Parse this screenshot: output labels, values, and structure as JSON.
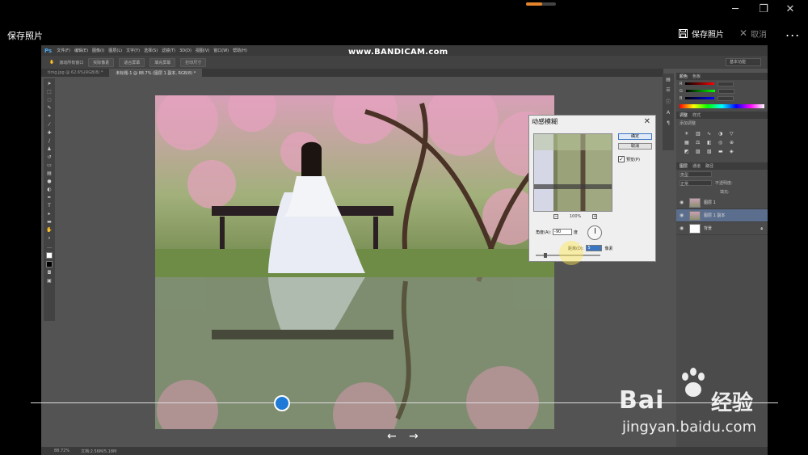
{
  "window": {
    "minimize_glyph": "─",
    "maximize_glyph": "❐",
    "close_glyph": "✕"
  },
  "viewer": {
    "title": "保存照片",
    "save_label": "保存照片",
    "cancel_label": "取消",
    "more_label": "...",
    "prev_glyph": "←",
    "next_glyph": "→",
    "accent_color": "#1e7ad6"
  },
  "photoshop": {
    "logo": "Ps",
    "menu": [
      "文件(F)",
      "编辑(E)",
      "图像(I)",
      "图层(L)",
      "文字(Y)",
      "选择(S)",
      "滤镜(T)",
      "3D(D)",
      "视图(V)",
      "窗口(W)",
      "帮助(H)"
    ],
    "recorder_watermark": "www.BANDICAM.com",
    "options": [
      "滚动所有窗口",
      "实际像素",
      "适合屏幕",
      "填充屏幕",
      "打印尺寸"
    ],
    "workspace": "基本功能",
    "tabs": [
      "timg.jpg @ 62.6%(RGB/8) *",
      "未标题-1 @ 88.7% (图层 1 副本, RGB/8) *"
    ],
    "status_zoom": "88.72%",
    "status_doc": "文档:2.56M/5.18M",
    "panels": {
      "color_tabs": [
        "颜色",
        "色板"
      ],
      "rgb_labels": [
        "R",
        "G",
        "B"
      ],
      "adjust_tabs": [
        "调整",
        "样式"
      ],
      "adjust_add": "添加调整",
      "layers_tabs": [
        "图层",
        "通道",
        "路径"
      ],
      "kind": "类型",
      "mode": "正常",
      "opacity": "不透明度:",
      "fill": "填充:",
      "layers": [
        {
          "name": "图层 1",
          "active": false
        },
        {
          "name": "图层 1 副本",
          "active": true
        },
        {
          "name": "背景",
          "active": false
        }
      ]
    }
  },
  "dialog": {
    "title": "动感模糊",
    "ok": "确定",
    "cancel": "取消",
    "preview_label": "预览(P)",
    "preview_checked": true,
    "zoom": "100%",
    "zoom_minus": "−",
    "zoom_plus": "+",
    "angle_label": "角度(A):",
    "angle_value": "-90",
    "angle_unit": "度",
    "distance_label": "距离(D):",
    "distance_value": "5",
    "distance_unit": "像素"
  },
  "watermark": {
    "brand": "Bai",
    "brand_cn": "经验",
    "url": "jingyan.baidu.com"
  }
}
